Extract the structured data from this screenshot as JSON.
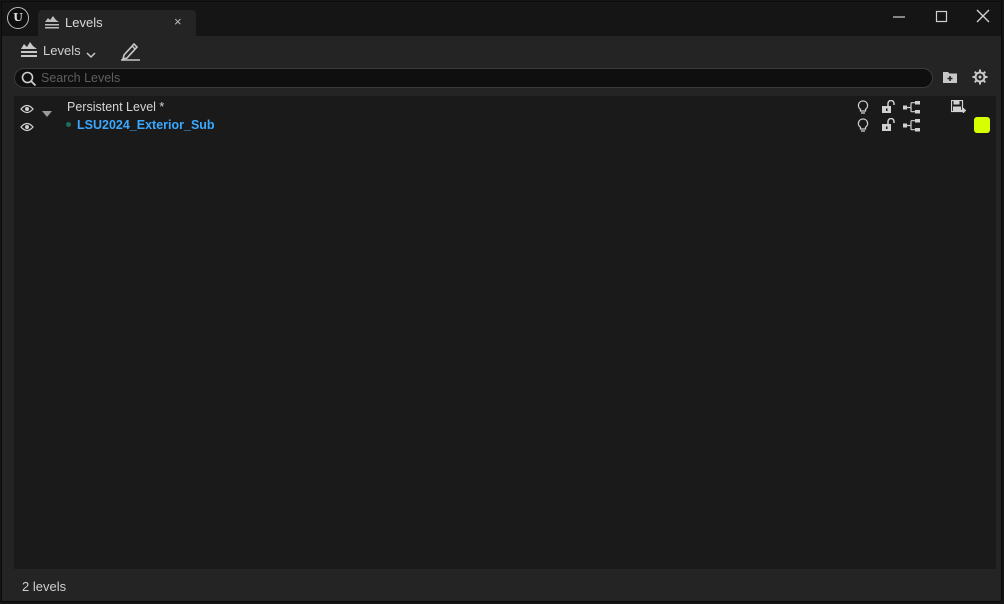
{
  "window": {
    "tab_title": "Levels",
    "tab_close": "×",
    "logo_text": "U",
    "controls": [
      "minimize-icon",
      "maximize-icon",
      "close-icon"
    ]
  },
  "toolbar": {
    "levels_label": "Levels",
    "levels_icon": "levels-stack-icon",
    "dropdown_icon": "chevron-down-icon",
    "edit_icon": "edit-pencil-icon"
  },
  "search": {
    "placeholder": "Search Levels",
    "value": "",
    "icon": "search-icon"
  },
  "actions": {
    "add_folder_icon": "add-folder-icon",
    "settings_icon": "gear-icon"
  },
  "levels": [
    {
      "name": "Persistent Level *",
      "visible": true,
      "expandable": true,
      "icons": [
        "lightbulb-icon",
        "unlock-icon",
        "hierarchy-icon",
        "save-icon"
      ]
    },
    {
      "name": "LSU2024_Exterior_Sub",
      "visible": true,
      "current": true,
      "icons": [
        "lightbulb-icon",
        "unlock-icon",
        "hierarchy-icon"
      ],
      "color": "#d7ff00"
    }
  ],
  "status": {
    "count_text": "2 levels"
  },
  "colors": {
    "accent_blue": "#3aa8ff",
    "level_color": "#d7ff00",
    "background": "#242424"
  }
}
